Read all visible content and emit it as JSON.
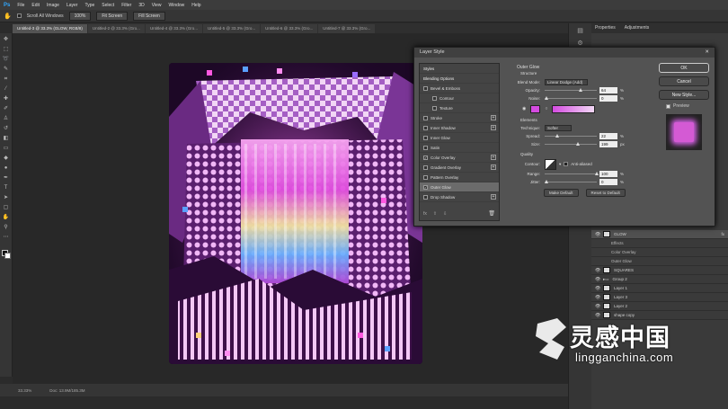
{
  "menubar": {
    "logo": "Ps",
    "items": [
      "File",
      "Edit",
      "Image",
      "Layer",
      "Type",
      "Select",
      "Filter",
      "3D",
      "View",
      "Window",
      "Help"
    ]
  },
  "options": {
    "scroll_all": "Scroll All Windows",
    "zoom": "100%",
    "fit": "Fit Screen",
    "fill": "Fill Screen"
  },
  "tabs": [
    "Untitled-3 @ 33.3% (GLOW, RGB/8)",
    "Untitled-2 @ 33.3% (Gro...",
    "Untitled-4 @ 33.3% (Gro...",
    "Untitled-5 @ 33.3% (Gro...",
    "Untitled-6 @ 33.3% (Gro...",
    "Untitled-7 @ 33.3% (Gro..."
  ],
  "status": {
    "zoom": "33.33%",
    "doc": "Doc: 13.9M/185.3M"
  },
  "panel": {
    "tab1": "Properties",
    "tab2": "Adjustments"
  },
  "layers": [
    {
      "name": "GLOW",
      "selected": true,
      "fx": "fx"
    },
    {
      "name": "Effects",
      "sub": true
    },
    {
      "name": "Color Overlay",
      "sub": true
    },
    {
      "name": "Outer Glow",
      "sub": true
    },
    {
      "name": "SQUARES"
    },
    {
      "name": "Group 2"
    },
    {
      "name": "Layer 1"
    },
    {
      "name": "Layer 3"
    },
    {
      "name": "Layer 2"
    },
    {
      "name": "shape copy"
    }
  ],
  "dialog": {
    "title": "Layer Style",
    "styles_header": "Styles",
    "blending": "Blending Options",
    "items": [
      {
        "label": "Bevel & Emboss",
        "checked": false,
        "plus": false
      },
      {
        "label": "Contour",
        "checked": false,
        "indent": true
      },
      {
        "label": "Texture",
        "checked": false,
        "indent": true
      },
      {
        "label": "Stroke",
        "checked": false,
        "plus": true
      },
      {
        "label": "Inner Shadow",
        "checked": false,
        "plus": true
      },
      {
        "label": "Inner Glow",
        "checked": false
      },
      {
        "label": "Satin",
        "checked": false
      },
      {
        "label": "Color Overlay",
        "checked": true,
        "plus": true
      },
      {
        "label": "Gradient Overlay",
        "checked": false,
        "plus": true
      },
      {
        "label": "Pattern Overlay",
        "checked": false
      },
      {
        "label": "Outer Glow",
        "checked": true,
        "selected": true
      },
      {
        "label": "Drop Shadow",
        "checked": false,
        "plus": true
      }
    ],
    "settings": {
      "section": "Outer Glow",
      "structure": "Structure",
      "blend_mode_label": "Blend Mode:",
      "blend_mode": "Linear Dodge (Add)",
      "opacity_label": "Opacity:",
      "opacity": "64",
      "noise_label": "Noise:",
      "noise": "0",
      "elements": "Elements",
      "technique_label": "Technique:",
      "technique": "Softer",
      "spread_label": "Spread:",
      "spread": "22",
      "size_label": "Size:",
      "size": "199",
      "quality": "Quality",
      "contour_label": "Contour:",
      "antialiased": "Anti-aliased",
      "range_label": "Range:",
      "range": "100",
      "jitter_label": "Jitter:",
      "jitter": "0",
      "make_default": "Make Default",
      "reset_default": "Reset to Default",
      "pct": "%",
      "px": "px"
    },
    "buttons": {
      "ok": "OK",
      "cancel": "Cancel",
      "new_style": "New Style...",
      "preview": "Preview"
    },
    "glow_color": "#d44be0"
  },
  "watermark": {
    "title": "灵感中国",
    "sub": "lingganchina.com"
  }
}
